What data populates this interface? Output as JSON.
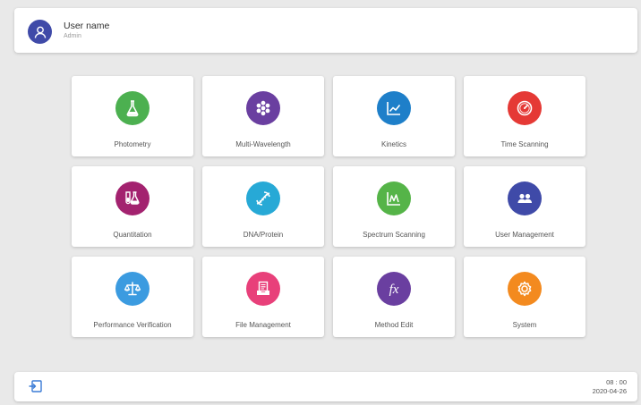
{
  "header": {
    "user_name": "User name",
    "user_role": "Admin"
  },
  "tiles": [
    {
      "label": "Photometry",
      "icon": "flask-icon",
      "color": "#4cb050"
    },
    {
      "label": "Multi-Wavelength",
      "icon": "cluster-icon",
      "color": "#6a3fa0"
    },
    {
      "label": "Kinetics",
      "icon": "trend-chart-icon",
      "color": "#1e7fc9"
    },
    {
      "label": "Time Scanning",
      "icon": "clock-icon",
      "color": "#e53935"
    },
    {
      "label": "Quantitation",
      "icon": "beakers-icon",
      "color": "#a3226f"
    },
    {
      "label": "DNA/Protein",
      "icon": "dna-icon",
      "color": "#27a9d6"
    },
    {
      "label": "Spectrum Scanning",
      "icon": "spectrum-chart-icon",
      "color": "#55b448"
    },
    {
      "label": "User Management",
      "icon": "users-icon",
      "color": "#3f4aa8"
    },
    {
      "label": "Performance Verification",
      "icon": "balance-scale-icon",
      "color": "#3b9be0"
    },
    {
      "label": "File Management",
      "icon": "file-tray-icon",
      "color": "#e8407a"
    },
    {
      "label": "Method Edit",
      "icon": "function-icon",
      "color": "#6a3fa0"
    },
    {
      "label": "System",
      "icon": "gear-icon",
      "color": "#f38a1f"
    }
  ],
  "footer": {
    "time": "08 : 00",
    "date": "2020-04-26"
  }
}
